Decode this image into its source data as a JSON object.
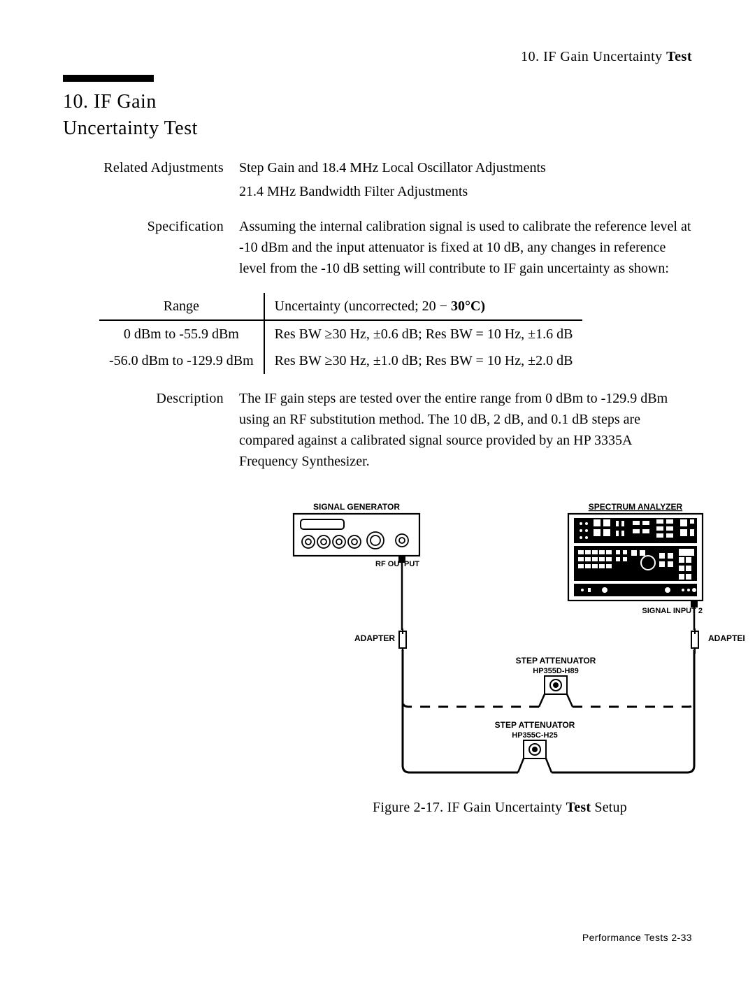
{
  "running_header": {
    "prefix": "10. IF Gain Uncertainty ",
    "bold": "Test"
  },
  "title": {
    "line1": "10. IF Gain",
    "line2": "Uncertainty Test"
  },
  "related_adjustments": {
    "label": "Related Adjustments",
    "lines": [
      "Step Gain and 18.4 MHz Local Oscillator Adjustments",
      "21.4 MHz Bandwidth Filter Adjustments"
    ]
  },
  "specification": {
    "label": "Specification",
    "text": "Assuming the internal calibration signal is used to calibrate the reference level at -10 dBm and the input attenuator is fixed at 10 dB, any changes in reference level from the -10 dB setting will contribute to IF gain uncertainty as shown:"
  },
  "spec_table": {
    "headers": {
      "range": "Range",
      "uncertainty_prefix": "Uncertainty (uncorrected; 20 − ",
      "uncertainty_bold": "30°C)"
    },
    "rows": [
      {
        "range": "0 dBm to -55.9 dBm",
        "uncertainty": "Res BW ≥30 Hz, ±0.6 dB; Res BW = 10 Hz, ±1.6 dB"
      },
      {
        "range": "-56.0 dBm to -129.9 dBm",
        "uncertainty": "Res BW ≥30 Hz, ±1.0 dB; Res BW = 10 Hz, ±2.0 dB"
      }
    ]
  },
  "description": {
    "label": "Description",
    "text": "The IF gain steps are tested over the entire range from 0 dBm to -129.9 dBm using an RF substitution method. The 10 dB, 2 dB, and 0.1 dB steps are compared against a calibrated signal source provided by an HP 3335A Frequency Synthesizer."
  },
  "figure": {
    "labels": {
      "signal_generator": "SIGNAL GENERATOR",
      "spectrum_analyzer": "SPECTRUM ANALYZER",
      "rf_output": "RF OUTPUT",
      "signal_input_2": "SIGNAL INPUT 2",
      "adapter_left": "ADAPTER",
      "adapter_right": "ADAPTER",
      "step_atten_1": "STEP ATTENUATOR",
      "step_atten_1_sub": "HP355D-H89",
      "step_atten_2": "STEP ATTENUATOR",
      "step_atten_2_sub": "HP355C-H25"
    },
    "caption_prefix": "Figure 2-17. IF Gain Uncertainty ",
    "caption_bold": "Test",
    "caption_suffix": " Setup"
  },
  "footer": "Performance Tests 2-33"
}
